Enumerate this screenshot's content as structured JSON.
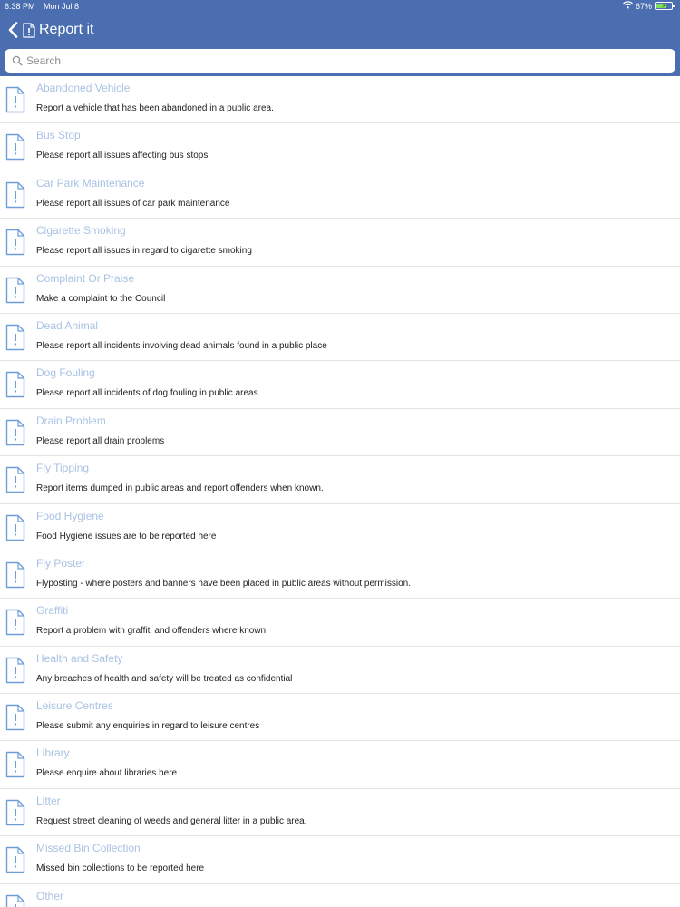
{
  "status_bar": {
    "time": "6:38 PM",
    "date": "Mon Jul 8",
    "battery_text": "67%",
    "battery_level": 0.67
  },
  "nav": {
    "title": "Report it"
  },
  "search": {
    "placeholder": "Search"
  },
  "colors": {
    "header": "#4a6eb0",
    "item_title": "#a9c2e3",
    "icon": "#6d9ed8"
  },
  "items": [
    {
      "title": "Abandoned Vehicle",
      "description": "Report a vehicle that has been abandoned in a public area."
    },
    {
      "title": "Bus Stop",
      "description": "Please report all issues affecting bus stops"
    },
    {
      "title": "Car Park Maintenance",
      "description": "Please report all issues of car park maintenance"
    },
    {
      "title": "Cigarette Smoking",
      "description": "Please report all issues in regard to cigarette smoking"
    },
    {
      "title": "Complaint Or Praise",
      "description": "Make a complaint to the Council"
    },
    {
      "title": "Dead Animal",
      "description": "Please report all incidents involving dead animals found in a public place"
    },
    {
      "title": "Dog Fouling",
      "description": "Please report all incidents of dog fouling in public areas"
    },
    {
      "title": "Drain Problem",
      "description": "Please report all drain problems"
    },
    {
      "title": "Fly Tipping",
      "description": "Report items dumped in public areas and report offenders when known."
    },
    {
      "title": "Food Hygiene",
      "description": "Food Hygiene issues are to be reported here"
    },
    {
      "title": "Fly Poster",
      "description": "Flyposting - where posters and banners have been placed in public areas without permission."
    },
    {
      "title": "Graffiti",
      "description": "Report a problem with graffiti and offenders where known."
    },
    {
      "title": "Health and Safety",
      "description": "Any breaches of health and safety will be treated as confidential"
    },
    {
      "title": "Leisure Centres",
      "description": "Please submit any enquiries in regard to leisure centres"
    },
    {
      "title": "Library",
      "description": "Please enquire about libraries here"
    },
    {
      "title": "Litter",
      "description": "Request street cleaning of weeds and general litter in a public area."
    },
    {
      "title": "Missed Bin Collection",
      "description": "Missed bin collections to be reported here"
    },
    {
      "title": "Other",
      "description": ""
    }
  ]
}
